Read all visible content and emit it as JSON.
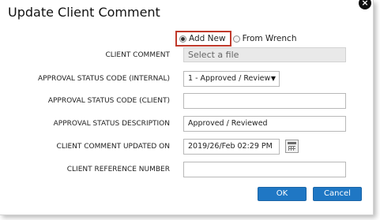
{
  "dialog": {
    "title": "Update Client Comment",
    "close_symbol": "×"
  },
  "source_options": [
    {
      "label": "Add New",
      "selected": true
    },
    {
      "label": "From Wrench",
      "selected": false
    }
  ],
  "form": {
    "client_comment": {
      "label": "CLIENT COMMENT",
      "placeholder": "Select a file"
    },
    "approval_status_internal": {
      "label": "APPROVAL STATUS CODE (INTERNAL)",
      "value": "1 - Approved / Reviewed"
    },
    "approval_status_client": {
      "label": "APPROVAL STATUS CODE (CLIENT)",
      "value": ""
    },
    "approval_status_description": {
      "label": "APPROVAL STATUS DESCRIPTION",
      "value": "Approved / Reviewed"
    },
    "comment_updated_on": {
      "label": "CLIENT COMMENT UPDATED ON",
      "value": "2019/26/Feb 02:29 PM"
    },
    "client_reference_number": {
      "label": "CLIENT REFERENCE NUMBER",
      "value": ""
    }
  },
  "buttons": {
    "ok": "OK",
    "cancel": "Cancel"
  },
  "colors": {
    "primary_button": "#1f77c4",
    "highlight_border": "#c0392b"
  }
}
